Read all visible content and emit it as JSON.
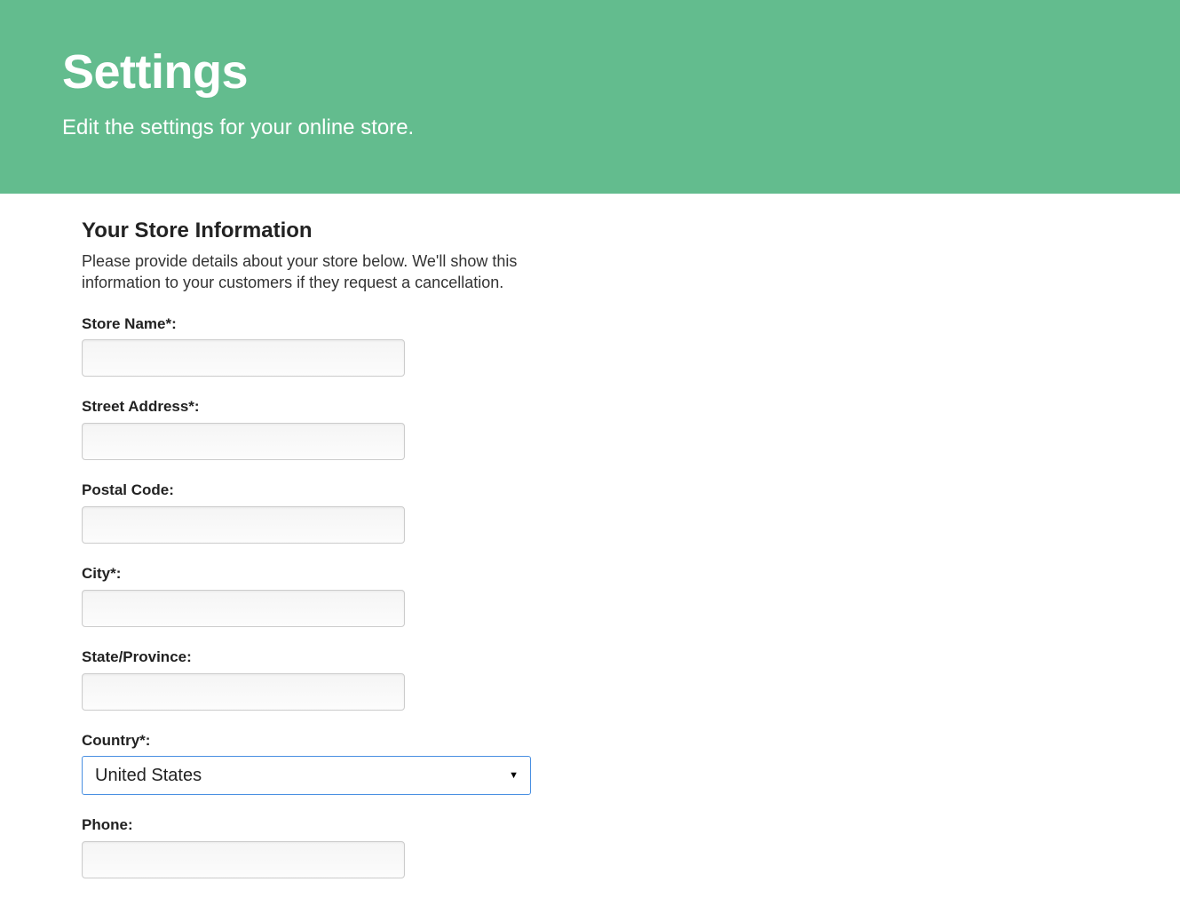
{
  "header": {
    "title": "Settings",
    "subtitle": "Edit the settings for your online store."
  },
  "section": {
    "title": "Your Store Information",
    "description": "Please provide details about your store below. We'll show this information to your customers if they request a cancellation."
  },
  "form": {
    "store_name": {
      "label": "Store Name*:",
      "value": ""
    },
    "street_address": {
      "label": "Street Address*:",
      "value": ""
    },
    "postal_code": {
      "label": "Postal Code:",
      "value": ""
    },
    "city": {
      "label": "City*:",
      "value": ""
    },
    "state_province": {
      "label": "State/Province:",
      "value": ""
    },
    "country": {
      "label": "Country*:",
      "selected": "United States"
    },
    "phone": {
      "label": "Phone:",
      "value": ""
    }
  }
}
